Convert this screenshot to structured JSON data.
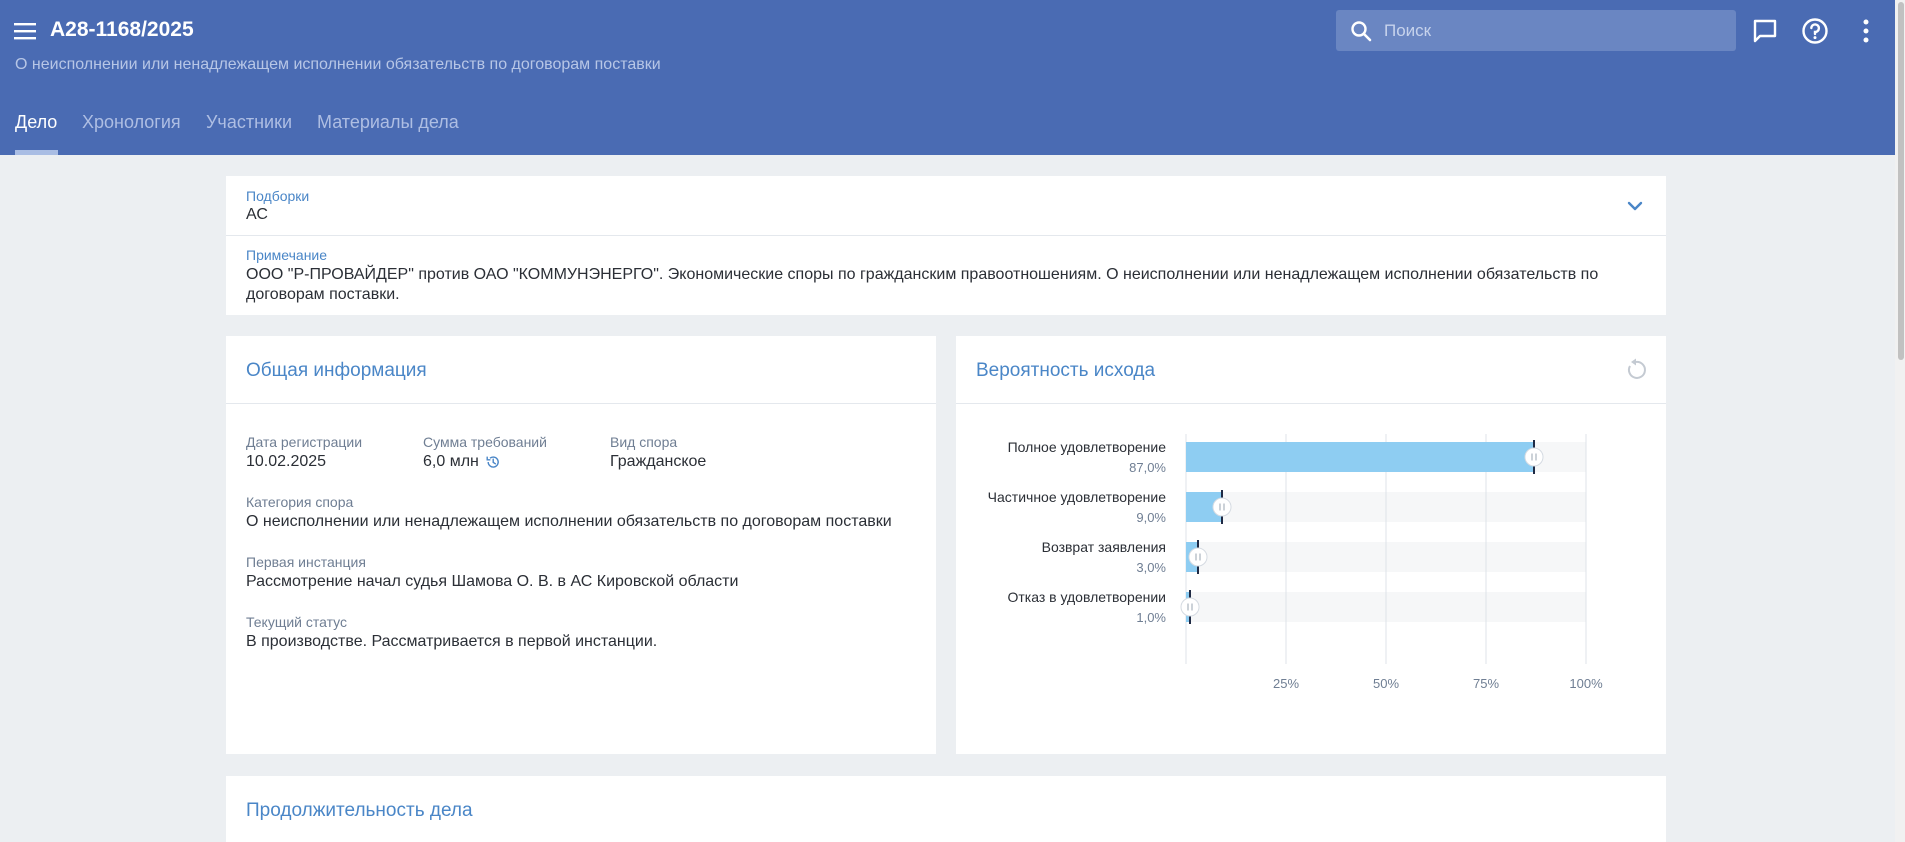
{
  "header": {
    "case_number": "А28-1168/2025",
    "subtitle": "О неисполнении или ненадлежащем исполнении обязательств по договорам поставки",
    "search_placeholder": "Поиск"
  },
  "tabs": [
    {
      "label": "Дело",
      "active": true
    },
    {
      "label": "Хронология",
      "active": false
    },
    {
      "label": "Участники",
      "active": false
    },
    {
      "label": "Материалы дела",
      "active": false
    }
  ],
  "collections": {
    "label": "Подборки",
    "value": "АС"
  },
  "note": {
    "label": "Примечание",
    "text": "ООО \"Р-ПРОВАЙДЕР\" против ОАО \"КОММУНЭНЕРГО\". Экономические споры по гражданским правоотношениям. О неисполнении или ненадлежащем исполнении обязательств по договорам поставки."
  },
  "general_info": {
    "title": "Общая информация",
    "registration_date": {
      "label": "Дата регистрации",
      "value": "10.02.2025"
    },
    "claim_amount": {
      "label": "Сумма требований",
      "value": "6,0 млн"
    },
    "dispute_type": {
      "label": "Вид спора",
      "value": "Гражданское"
    },
    "category": {
      "label": "Категория спора",
      "value": "О неисполнении или ненадлежащем исполнении обязательств по договорам поставки"
    },
    "first_instance": {
      "label": "Первая инстанция",
      "value": "Рассмотрение начал судья Шамова О. В. в АС Кировской области"
    },
    "status": {
      "label": "Текущий статус",
      "value": "В производстве. Рассматривается в первой инстанции."
    }
  },
  "outcome": {
    "title": "Вероятность исхода"
  },
  "duration": {
    "title": "Продолжительность дела"
  },
  "chart_data": {
    "type": "bar",
    "orientation": "horizontal",
    "categories": [
      "Полное удовлетворение",
      "Частичное удовлетворение",
      "Возврат заявления",
      "Отказ в удовлетворении"
    ],
    "values": [
      87.0,
      9.0,
      3.0,
      1.0
    ],
    "value_labels": [
      "87,0%",
      "9,0%",
      "3,0%",
      "1,0%"
    ],
    "xlim": [
      0,
      100
    ],
    "x_ticks": [
      25,
      50,
      75,
      100
    ],
    "x_tick_labels": [
      "25%",
      "50%",
      "75%",
      "100%"
    ],
    "bar_color": "#8ecdf2",
    "track_color": "#f6f7f8",
    "grid": true
  },
  "colors": {
    "header": "#4a6bb3",
    "accent": "#4a86c7",
    "background": "#eceff2"
  }
}
